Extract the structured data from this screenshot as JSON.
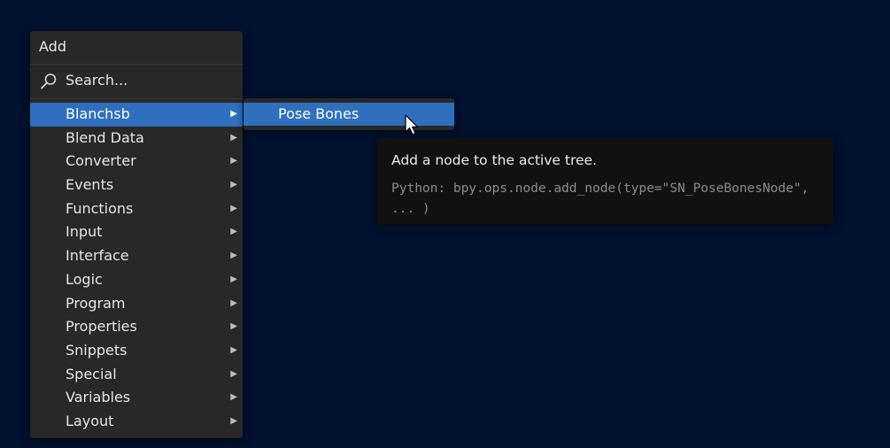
{
  "menu": {
    "title": "Add",
    "search_label": "Search...",
    "items": [
      {
        "label": "Blanchsb",
        "active": true
      },
      {
        "label": "Blend Data"
      },
      {
        "label": "Converter"
      },
      {
        "label": "Events"
      },
      {
        "label": "Functions"
      },
      {
        "label": "Input"
      },
      {
        "label": "Interface"
      },
      {
        "label": "Logic"
      },
      {
        "label": "Program"
      },
      {
        "label": "Properties"
      },
      {
        "label": "Snippets"
      },
      {
        "label": "Special"
      },
      {
        "label": "Variables"
      },
      {
        "label": "Layout"
      }
    ]
  },
  "submenu": {
    "items": [
      {
        "label": "Pose Bones"
      }
    ]
  },
  "tooltip": {
    "description": "Add a node to the active tree.",
    "python": "Python: bpy.ops.node.add_node(type=\"SN_PoseBonesNode\",\n... )"
  },
  "icons": {
    "search": "search-icon",
    "submenu_arrow": "triangle-right-icon",
    "cursor": "mouse-pointer-icon"
  },
  "colors": {
    "background": "#01112f",
    "menu_bg": "#282828",
    "highlight": "#2f6fbd",
    "tooltip_bg": "#111111"
  }
}
